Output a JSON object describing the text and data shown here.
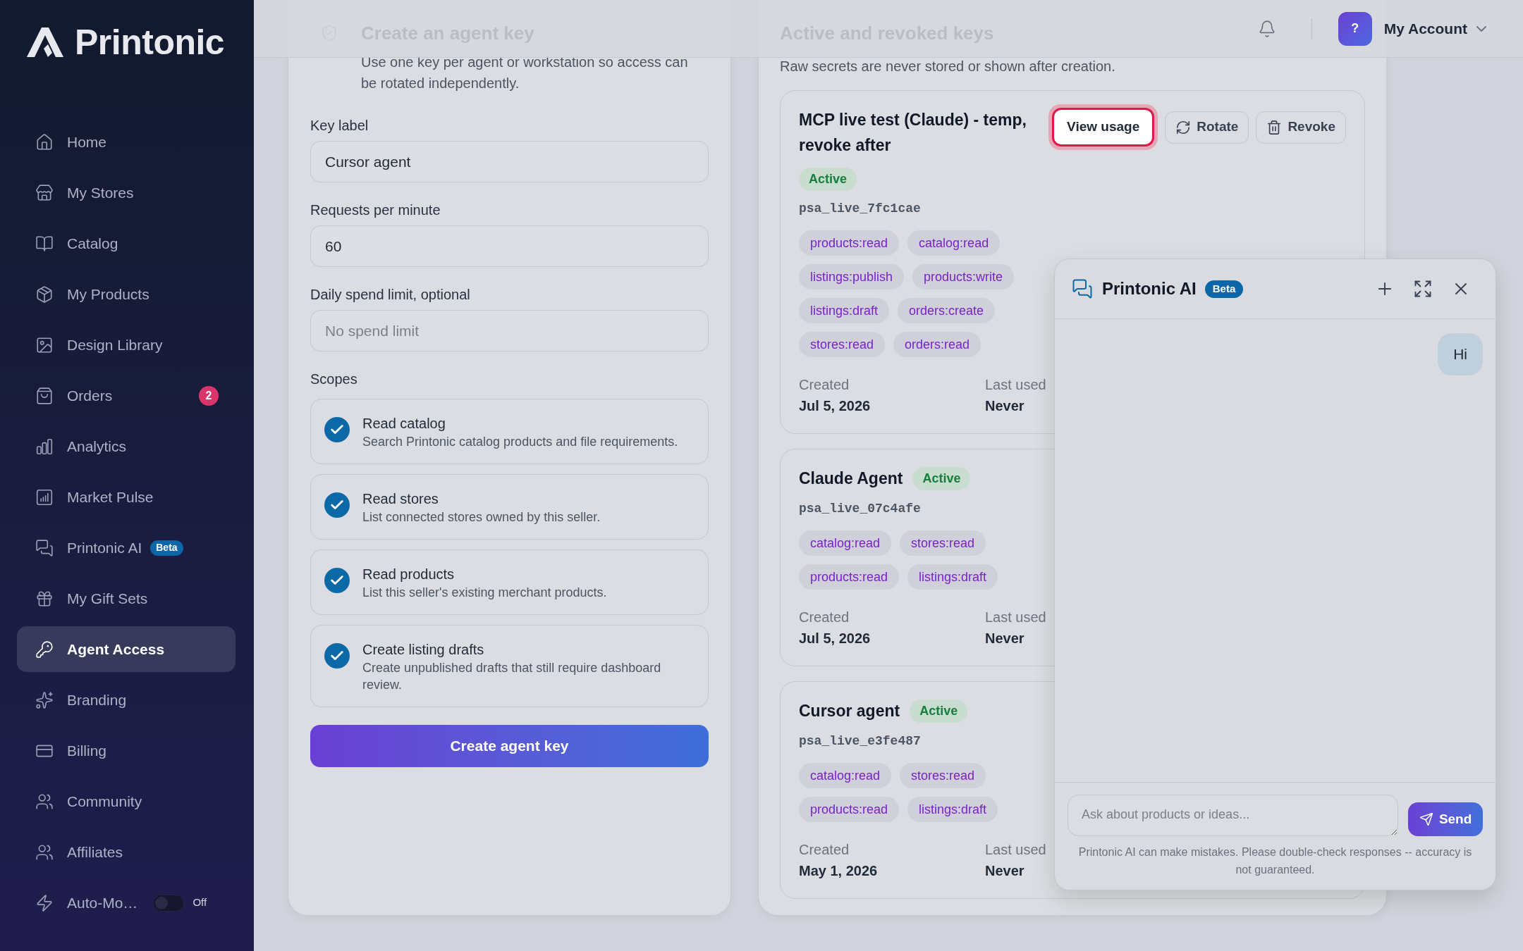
{
  "sidebar": {
    "logo": "Printonic",
    "items": [
      {
        "kind": "link",
        "label": "Home",
        "selected": false
      },
      {
        "kind": "link",
        "label": "My Stores",
        "selected": false
      },
      {
        "kind": "link",
        "label": "Catalog",
        "selected": false
      },
      {
        "kind": "link",
        "label": "My Products",
        "selected": false
      },
      {
        "kind": "link",
        "label": "Design Library",
        "selected": false
      },
      {
        "kind": "link",
        "label": "Orders",
        "selected": false,
        "badge": "2"
      },
      {
        "kind": "link",
        "label": "Analytics",
        "selected": false
      },
      {
        "kind": "link",
        "label": "Market Pulse",
        "selected": false
      },
      {
        "kind": "link",
        "label": "Printonic AI",
        "selected": false,
        "tag": "Beta"
      },
      {
        "kind": "link",
        "label": "My Gift Sets",
        "selected": false
      },
      {
        "kind": "link",
        "label": "Agent Access",
        "selected": true
      },
      {
        "kind": "link",
        "label": "Branding",
        "selected": false
      },
      {
        "kind": "link",
        "label": "Billing",
        "selected": false
      },
      {
        "kind": "link",
        "label": "Community",
        "selected": false
      },
      {
        "kind": "link",
        "label": "Affiliates",
        "selected": false
      },
      {
        "kind": "toggle",
        "label": "Auto-Mo…",
        "selected": false,
        "on": false,
        "state_label": "Off"
      }
    ]
  },
  "header": {
    "avatar": "?",
    "account": "My Account"
  },
  "create_key": {
    "title": "Create an agent key",
    "description": "Use one key per agent or workstation so access can be rotated independently.",
    "fields": [
      {
        "label": "Key label",
        "value": "Cursor agent"
      },
      {
        "label": "Requests per minute",
        "value": "60"
      },
      {
        "label": "Daily spend limit, optional",
        "placeholder": "No spend limit"
      }
    ],
    "scopes_label": "Scopes",
    "scopes": [
      {
        "title": "Read catalog",
        "description": "Search Printonic catalog products and file requirements.",
        "checked": true
      },
      {
        "title": "Read stores",
        "description": "List connected stores owned by this seller.",
        "checked": true
      },
      {
        "title": "Read products",
        "description": "List this seller's existing merchant products.",
        "checked": true
      },
      {
        "title": "Create listing drafts",
        "description": "Create unpublished drafts that still require dashboard review.",
        "checked": true
      }
    ],
    "submit": "Create agent key"
  },
  "keys_panel": {
    "title": "Active and revoked keys",
    "description": "Raw secrets are never stored or shown after creation.",
    "keys": [
      {
        "name": "MCP live test (Claude) - temp, revoke after",
        "status": "Active",
        "key_id": "psa_live_7fc1cae",
        "actions": [
          {
            "label": "View usage",
            "highlighted": true
          },
          {
            "label": "Rotate",
            "highlighted": false
          },
          {
            "label": "Revoke",
            "highlighted": false
          }
        ],
        "scopes": [
          "products:read",
          "catalog:read",
          "listings:publish",
          "products:write",
          "listings:draft",
          "orders:create",
          "stores:read",
          "orders:read"
        ],
        "created_label": "Created",
        "created": "Jul 5, 2026",
        "last_used_label": "Last used",
        "last_used": "Never"
      },
      {
        "name": "Claude Agent",
        "status": "Active",
        "key_id": "psa_live_07c4afe",
        "scopes": [
          "catalog:read",
          "stores:read",
          "products:read",
          "listings:draft"
        ],
        "created_label": "Created",
        "created": "Jul 5, 2026",
        "last_used_label": "Last used",
        "last_used": "Never"
      },
      {
        "name": "Cursor agent",
        "status": "Active",
        "key_id": "psa_live_e3fe487",
        "scopes": [
          "catalog:read",
          "stores:read",
          "products:read",
          "listings:draft"
        ],
        "created_label": "Created",
        "created": "May 1, 2026",
        "last_used_label": "Last used",
        "last_used": "Never"
      }
    ]
  },
  "chat": {
    "title": "Printonic AI",
    "tag": "Beta",
    "messages": [
      {
        "kind": "outgoing",
        "text": "Hi"
      }
    ],
    "input": {
      "placeholder": "Ask about products or ideas..."
    },
    "send": "Send",
    "disclaimer": "Printonic AI can make mistakes. Please double-check responses -- accuracy is not guaranteed."
  }
}
